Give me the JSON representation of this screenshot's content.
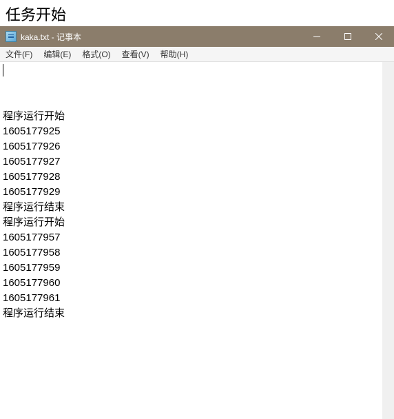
{
  "outer": {
    "title": "任务开始"
  },
  "window": {
    "title": "kaka.txt - 记事本"
  },
  "menu": {
    "file": "文件(F)",
    "edit": "编辑(E)",
    "format": "格式(O)",
    "view": "查看(V)",
    "help": "帮助(H)"
  },
  "content": {
    "lines": [
      "程序运行开始",
      "1605177925",
      "1605177926",
      "1605177927",
      "1605177928",
      "1605177929",
      "程序运行结束",
      "程序运行开始",
      "1605177957",
      "1605177958",
      "1605177959",
      "1605177960",
      "1605177961",
      "程序运行结束"
    ]
  }
}
